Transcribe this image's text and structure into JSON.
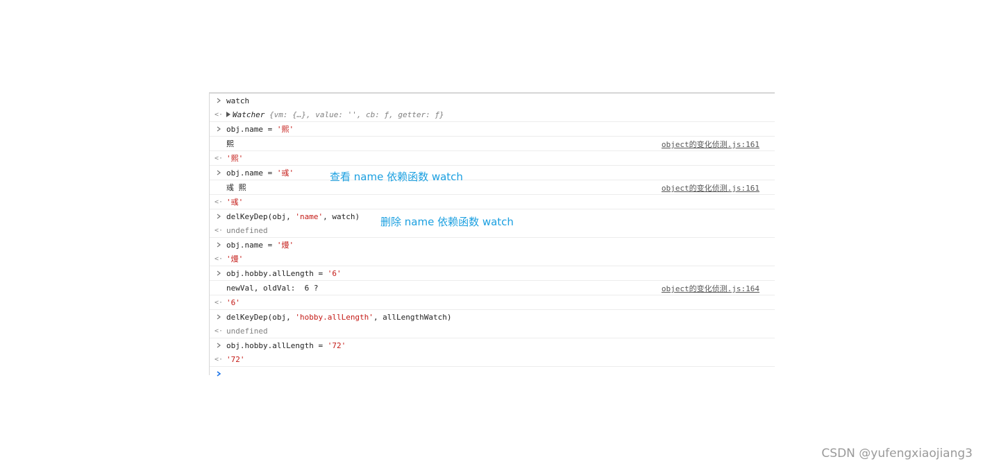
{
  "console": {
    "entries": [
      {
        "kind": "input",
        "text": "watch"
      },
      {
        "kind": "output",
        "prefix": "Watcher ",
        "body": "{vm: {…}, value: '', cb: ƒ, getter: ƒ}"
      },
      {
        "kind": "input",
        "code": "obj.name = ",
        "str": "'熙'"
      },
      {
        "kind": "log",
        "text": "熙",
        "source": "object的变化侦测.js:161"
      },
      {
        "kind": "result",
        "str": "'熙'"
      },
      {
        "kind": "input",
        "code": "obj.name = ",
        "str": "'彧'"
      },
      {
        "kind": "log",
        "text": "彧 熙",
        "source": "object的变化侦测.js:161"
      },
      {
        "kind": "result",
        "str": "'彧'"
      },
      {
        "kind": "input",
        "code_before": "delKeyDep(obj, ",
        "str": "'name'",
        "code_after": ", watch)"
      },
      {
        "kind": "result_muted",
        "text": "undefined"
      },
      {
        "kind": "input",
        "code": "obj.name = ",
        "str": "'熳'"
      },
      {
        "kind": "result",
        "str": "'熳'"
      },
      {
        "kind": "input",
        "code": "obj.hobby.allLength = ",
        "str": "'6'"
      },
      {
        "kind": "log",
        "text": "newVal, oldVal:  6 ?",
        "source": "object的变化侦测.js:164"
      },
      {
        "kind": "result",
        "str": "'6'"
      },
      {
        "kind": "input",
        "code_before": "delKeyDep(obj, ",
        "str": "'hobby.allLength'",
        "code_after": ", allLengthWatch)"
      },
      {
        "kind": "result_muted",
        "text": "undefined"
      },
      {
        "kind": "input",
        "code": "obj.hobby.allLength = ",
        "str": "'72'"
      },
      {
        "kind": "result",
        "str": "'72'"
      }
    ]
  },
  "annotations": {
    "note1": "查看 name 依赖函数 watch",
    "note2": "删除 name 依赖函数 watch"
  },
  "watermark": "CSDN @yufengxiaojiang3",
  "colors": {
    "string": "#c41a16",
    "annotation": "#1a9fe0",
    "prompt": "#1a73e8"
  }
}
